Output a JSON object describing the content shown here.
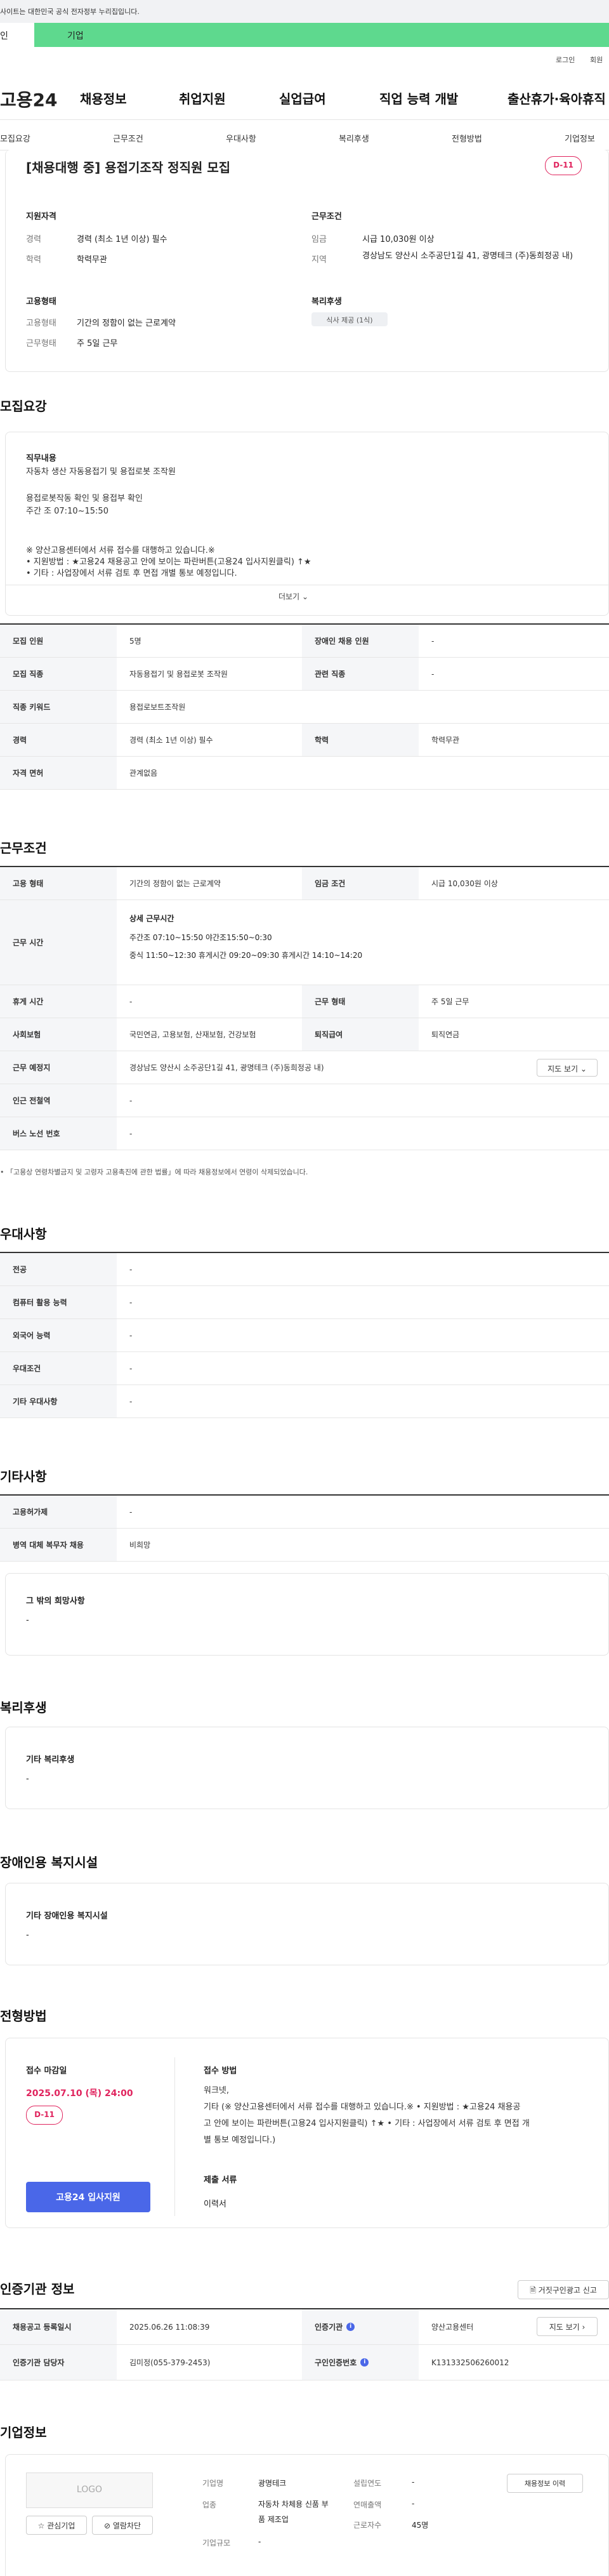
{
  "gov": {
    "banner": "사이트는 대한민국 공식 전자정부 누리집입니다."
  },
  "toptabs": {
    "individual": "인",
    "corporate": "기업"
  },
  "util": {
    "login": "로그인",
    "join": "회원"
  },
  "logo": "고용24",
  "gnb": [
    "채용정보",
    "취업지원",
    "실업급여",
    "직업 능력 개발",
    "출산휴가·육아휴직"
  ],
  "subnav": [
    "모집요강",
    "근무조건",
    "우대사항",
    "복리후생",
    "전형방법",
    "기업정보"
  ],
  "job": {
    "title": "[채용대행 중] 용접기조작 정직원 모집",
    "dday": "D-11"
  },
  "summary": {
    "qual_title": "지원자격",
    "cond_title": "근무조건",
    "emp_title": "고용형태",
    "welfare_title": "복리후생",
    "career_label": "경력",
    "career": "경력 (최소 1년 이상) 필수",
    "edu_label": "학력",
    "edu": "학력무관",
    "wage_label": "임금",
    "wage": "시급 10,030원 이상",
    "region_label": "지역",
    "region": "경상남도 양산시 소주공단1길 41, 광명테크 (주)동희정공 내)",
    "type_label": "고용형태",
    "type": "기간의 정함이 없는 근로계약",
    "form_label": "근무형태",
    "form": "주 5일 근무",
    "welfare_chip": "식사 제공 (1식)"
  },
  "recruit": {
    "heading": "모집요강",
    "duty_title": "직무내용",
    "duty_lines": [
      "자동차 생산 자동용접기  및 용접로봇 조작원",
      "",
      "  용접로봇작동 확인 및 용접부 확인",
      "주간 조 07:10~15:50",
      "",
      "※ 양산고용센터에서 서류 접수를 대행하고 있습니다.※",
      "• 지원방법 : ★고용24 채용공고 안에 보이는 파란버튼(고용24 입사지원클릭) ↑★",
      "• 기타 : 사업장에서 서류 검토 후 면접 개별 통보 예정입니다."
    ],
    "more": "더보기",
    "table": [
      [
        "모집 인원",
        "5명",
        "장애인 채용 인원",
        "-"
      ],
      [
        "모집 직종",
        "자동용접기 및 용접로봇 조작원",
        "관련 직종",
        "-"
      ],
      [
        "직종 키워드",
        "용접로보트조작원",
        "",
        ""
      ],
      [
        "경력",
        "경력 (최소 1년 이상) 필수",
        "학력",
        "학력무관"
      ],
      [
        "자격 면허",
        "관계없음",
        "",
        ""
      ]
    ]
  },
  "condition": {
    "heading": "근무조건",
    "rows": [
      [
        "고용 형태",
        "기간의 정함이 없는 근로계약",
        "임금 조건",
        "시급 10,030원 이상"
      ],
      [
        "휴게 시간",
        "-",
        "근무 형태",
        "주 5일 근무"
      ],
      [
        "사회보험",
        "국민연금, 고용보험, 산재보험, 건강보험",
        "퇴직급여",
        "퇴직연금"
      ]
    ],
    "time_label": "근무 시간",
    "time_title": "상세 근무시간",
    "time_line1": "주간조 07:10~15:50   야간조15:50~0:30",
    "time_line2": "중식 11:50~12:30   휴게시간 09:20~09:30   휴게시간 14:10~14:20",
    "place_label": "근무 예정지",
    "place": "경상남도 양산시 소주공단1길 41, 광명테크 (주)동희정공 내)",
    "map_btn": "지도 보기",
    "station_label": "인근 전철역",
    "station": "-",
    "bus_label": "버스 노선 번호",
    "bus": "-",
    "footnote": "「고용상 연령차별금지 및 고령자 고용촉진에 관한 법률」에 따라 채용정보에서 연령이 삭제되었습니다."
  },
  "prefer": {
    "heading": "우대사항",
    "rows": [
      [
        "전공",
        "-"
      ],
      [
        "컴퓨터 활용 능력",
        "-"
      ],
      [
        "외국어 능력",
        "-"
      ],
      [
        "우대조건",
        "-"
      ],
      [
        "기타 우대사항",
        "-"
      ]
    ]
  },
  "etc": {
    "heading": "기타사항",
    "rows": [
      [
        "고용허가제",
        "-"
      ],
      [
        "병역 대체 복무자 채용",
        "비희망"
      ]
    ],
    "box_title": "그 밖의 희망사항",
    "box_val": "-"
  },
  "welfare": {
    "heading": "복리후생",
    "title": "기타 복리후생",
    "val": "-"
  },
  "disability": {
    "heading": "장애인용 복지시설",
    "title": "기타 장애인용 복지시설",
    "val": "-"
  },
  "process": {
    "heading": "전형방법",
    "deadline_title": "접수 마감일",
    "deadline": "2025.07.10 (목) 24:00",
    "dday": "D-11",
    "apply_btn": "고용24 입사지원",
    "method_title": "접수 방법",
    "method_lines": [
      "워크넷,",
      "기타 (※ 양산고용센터에서 서류 접수를 대행하고 있습니다.※ • 지원방법 : ★고용24 채용공",
      "고 안에 보이는 파란버튼(고용24 입사지원클릭) ↑★ • 기타 : 사업장에서 서류 검토 후 면접 개",
      "별 통보 예정입니다.)"
    ],
    "docs_title": "제출 서류",
    "docs": "이력서"
  },
  "agency": {
    "heading": "인증기관 정보",
    "report_btn": "거짓구인광고 신고",
    "rows": [
      [
        "채용공고 등록일시",
        "2025.06.26 11:08:39",
        "인증기관",
        "양산고용센터"
      ],
      [
        "인증기관 담당자",
        "김미정(055-379-2453)",
        "구인인증번호",
        "K131332506260012"
      ]
    ],
    "map_btn": "지도 보기"
  },
  "company": {
    "heading": "기업정보",
    "logo": "LOGO",
    "fav": "관심기업",
    "block": "열람차단",
    "name_label": "기업명",
    "name": "광명테크",
    "industry_label": "업종",
    "industry": "자동차 차체용 신품 부품 제조업",
    "scale_label": "기업규모",
    "scale": "-",
    "year_label": "설립연도",
    "year": "-",
    "sales_label": "연매출액",
    "sales": "-",
    "workers_label": "근로자수",
    "workers": "45명",
    "recruit_btn": "채용정보 이력"
  }
}
